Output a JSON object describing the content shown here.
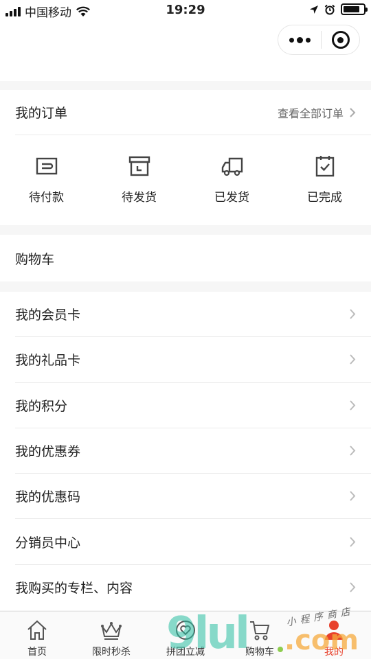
{
  "status_bar": {
    "carrier": "中国移动",
    "time": "19:29"
  },
  "orders": {
    "title": "我的订单",
    "view_all": "查看全部订单",
    "items": [
      {
        "label": "待付款",
        "icon": "wallet-icon"
      },
      {
        "label": "待发货",
        "icon": "box-icon"
      },
      {
        "label": "已发货",
        "icon": "truck-icon"
      },
      {
        "label": "已完成",
        "icon": "clipboard-check-icon"
      }
    ]
  },
  "cart": {
    "title": "购物车"
  },
  "menu": [
    {
      "label": "我的会员卡"
    },
    {
      "label": "我的礼品卡"
    },
    {
      "label": "我的积分"
    },
    {
      "label": "我的优惠券"
    },
    {
      "label": "我的优惠码"
    },
    {
      "label": "分销员中心"
    },
    {
      "label": "我购买的专栏、内容"
    }
  ],
  "tabbar": [
    {
      "label": "首页",
      "icon": "home-icon"
    },
    {
      "label": "限时秒杀",
      "icon": "crown-icon"
    },
    {
      "label": "拼团立减",
      "icon": "heart-icon"
    },
    {
      "label": "购物车",
      "icon": "cart-icon"
    },
    {
      "label": "我的",
      "icon": "user-icon",
      "active": true
    }
  ],
  "watermark": {
    "big": "9lul",
    "com": ".com",
    "small": "小程序商店"
  },
  "colors": {
    "accent": "#e8412c",
    "background": "#f6f6f6",
    "divider": "#ebebeb"
  }
}
